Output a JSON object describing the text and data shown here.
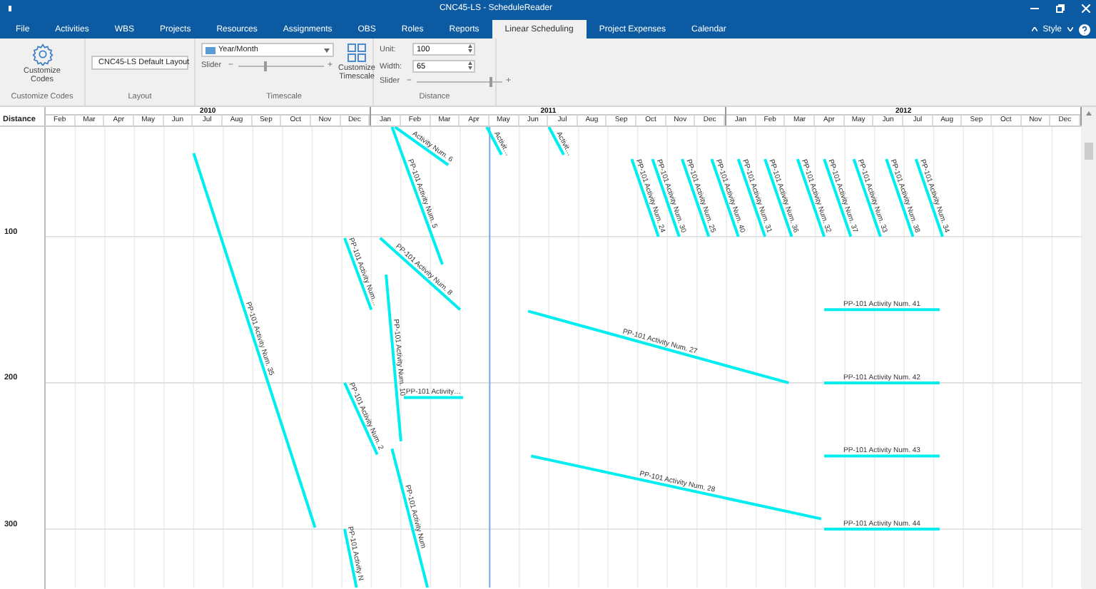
{
  "window": {
    "title": "CNC45-LS - ScheduleReader"
  },
  "tabs": [
    {
      "label": "File",
      "selected": false
    },
    {
      "label": "Activities",
      "selected": false
    },
    {
      "label": "WBS",
      "selected": false
    },
    {
      "label": "Projects",
      "selected": false
    },
    {
      "label": "Resources",
      "selected": false
    },
    {
      "label": "Assignments",
      "selected": false
    },
    {
      "label": "OBS",
      "selected": false
    },
    {
      "label": "Roles",
      "selected": false
    },
    {
      "label": "Reports",
      "selected": false
    },
    {
      "label": "Linear Scheduling",
      "selected": true
    },
    {
      "label": "Project Expenses",
      "selected": false
    },
    {
      "label": "Calendar",
      "selected": false
    }
  ],
  "style_menu": {
    "label": "Style"
  },
  "ribbon": {
    "groups": [
      {
        "kind": "codes",
        "label": "Customize Codes",
        "button": "Customize Codes"
      },
      {
        "kind": "layout",
        "label": "Layout",
        "dropdown": "CNC45-LS Default Layout"
      },
      {
        "kind": "timescale",
        "label": "Timescale",
        "dropdown": "Year/Month",
        "slider_label": "Slider",
        "slider_minus": "−",
        "slider_plus": "+",
        "level": 0.3,
        "button": "Customize Timescale"
      },
      {
        "kind": "distance",
        "label": "Distance",
        "fields": [
          {
            "label": "Unit:",
            "value": "100"
          },
          {
            "label": "Width:",
            "value": "65"
          }
        ],
        "slider_label": "Slider",
        "slider_minus": "−",
        "slider_plus": "+",
        "level": 0.85
      }
    ]
  },
  "timeline": {
    "corner": "Distance",
    "years": [
      {
        "label": "2010",
        "months": [
          "Feb",
          "Mar",
          "Apr",
          "May",
          "Jun",
          "Jul",
          "Aug",
          "Sep",
          "Oct",
          "Nov",
          "Dec"
        ]
      },
      {
        "label": "2011",
        "months": [
          "Jan",
          "Feb",
          "Mar",
          "Apr",
          "May",
          "Jun",
          "Jul",
          "Aug",
          "Sep",
          "Oct",
          "Nov",
          "Dec"
        ]
      },
      {
        "label": "2012",
        "months": [
          "Jan",
          "Feb",
          "Mar",
          "Apr",
          "May",
          "Jun",
          "Jul",
          "Aug",
          "Sep",
          "Oct",
          "Nov",
          "Dec"
        ]
      }
    ]
  },
  "distance_labels": [
    "100",
    "200",
    "300"
  ],
  "activities": [
    {
      "label": "PP-101 Activity Num. 35"
    },
    {
      "label": "Activity Num. 6"
    },
    {
      "label": "PP-101 Activity Num. 5"
    },
    {
      "label": "Activit…"
    },
    {
      "label": "Activit…"
    },
    {
      "label": "PP-101 Activity Num. 24"
    },
    {
      "label": "PP-101 Activity Num. 30"
    },
    {
      "label": "PP-101 Activity Num. 25"
    },
    {
      "label": "PP-101 Activity Num. 40"
    },
    {
      "label": "PP-101 Activity Num. 31"
    },
    {
      "label": "PP-101 Activity Num. 36"
    },
    {
      "label": "PP-101 Activity Num. 32"
    },
    {
      "label": "PP-101 Activity Num. 37"
    },
    {
      "label": "PP-101 Activity Num. 33"
    },
    {
      "label": "PP-101 Activity Num. 38"
    },
    {
      "label": "PP-101 Activity Num. 34"
    },
    {
      "label": "PP-101 Activity Num…"
    },
    {
      "label": "PP-101 Activity Num. 8"
    },
    {
      "label": "PP-101 Activity Num. 10"
    },
    {
      "label": "PP-101 Activity…"
    },
    {
      "label": "PP-101 Activity Num. 2"
    },
    {
      "label": "PP-101 Activity Num"
    },
    {
      "label": "PP-101 Activity N"
    },
    {
      "label": "PP-101 Activity Num. 27"
    },
    {
      "label": "PP-101 Activity Num. 28"
    },
    {
      "label": "PP-101 Activity Num. 41"
    },
    {
      "label": "PP-101 Activity Num. 42"
    },
    {
      "label": "PP-101 Activity Num. 43"
    },
    {
      "label": "PP-101 Activity Num. 44"
    }
  ]
}
